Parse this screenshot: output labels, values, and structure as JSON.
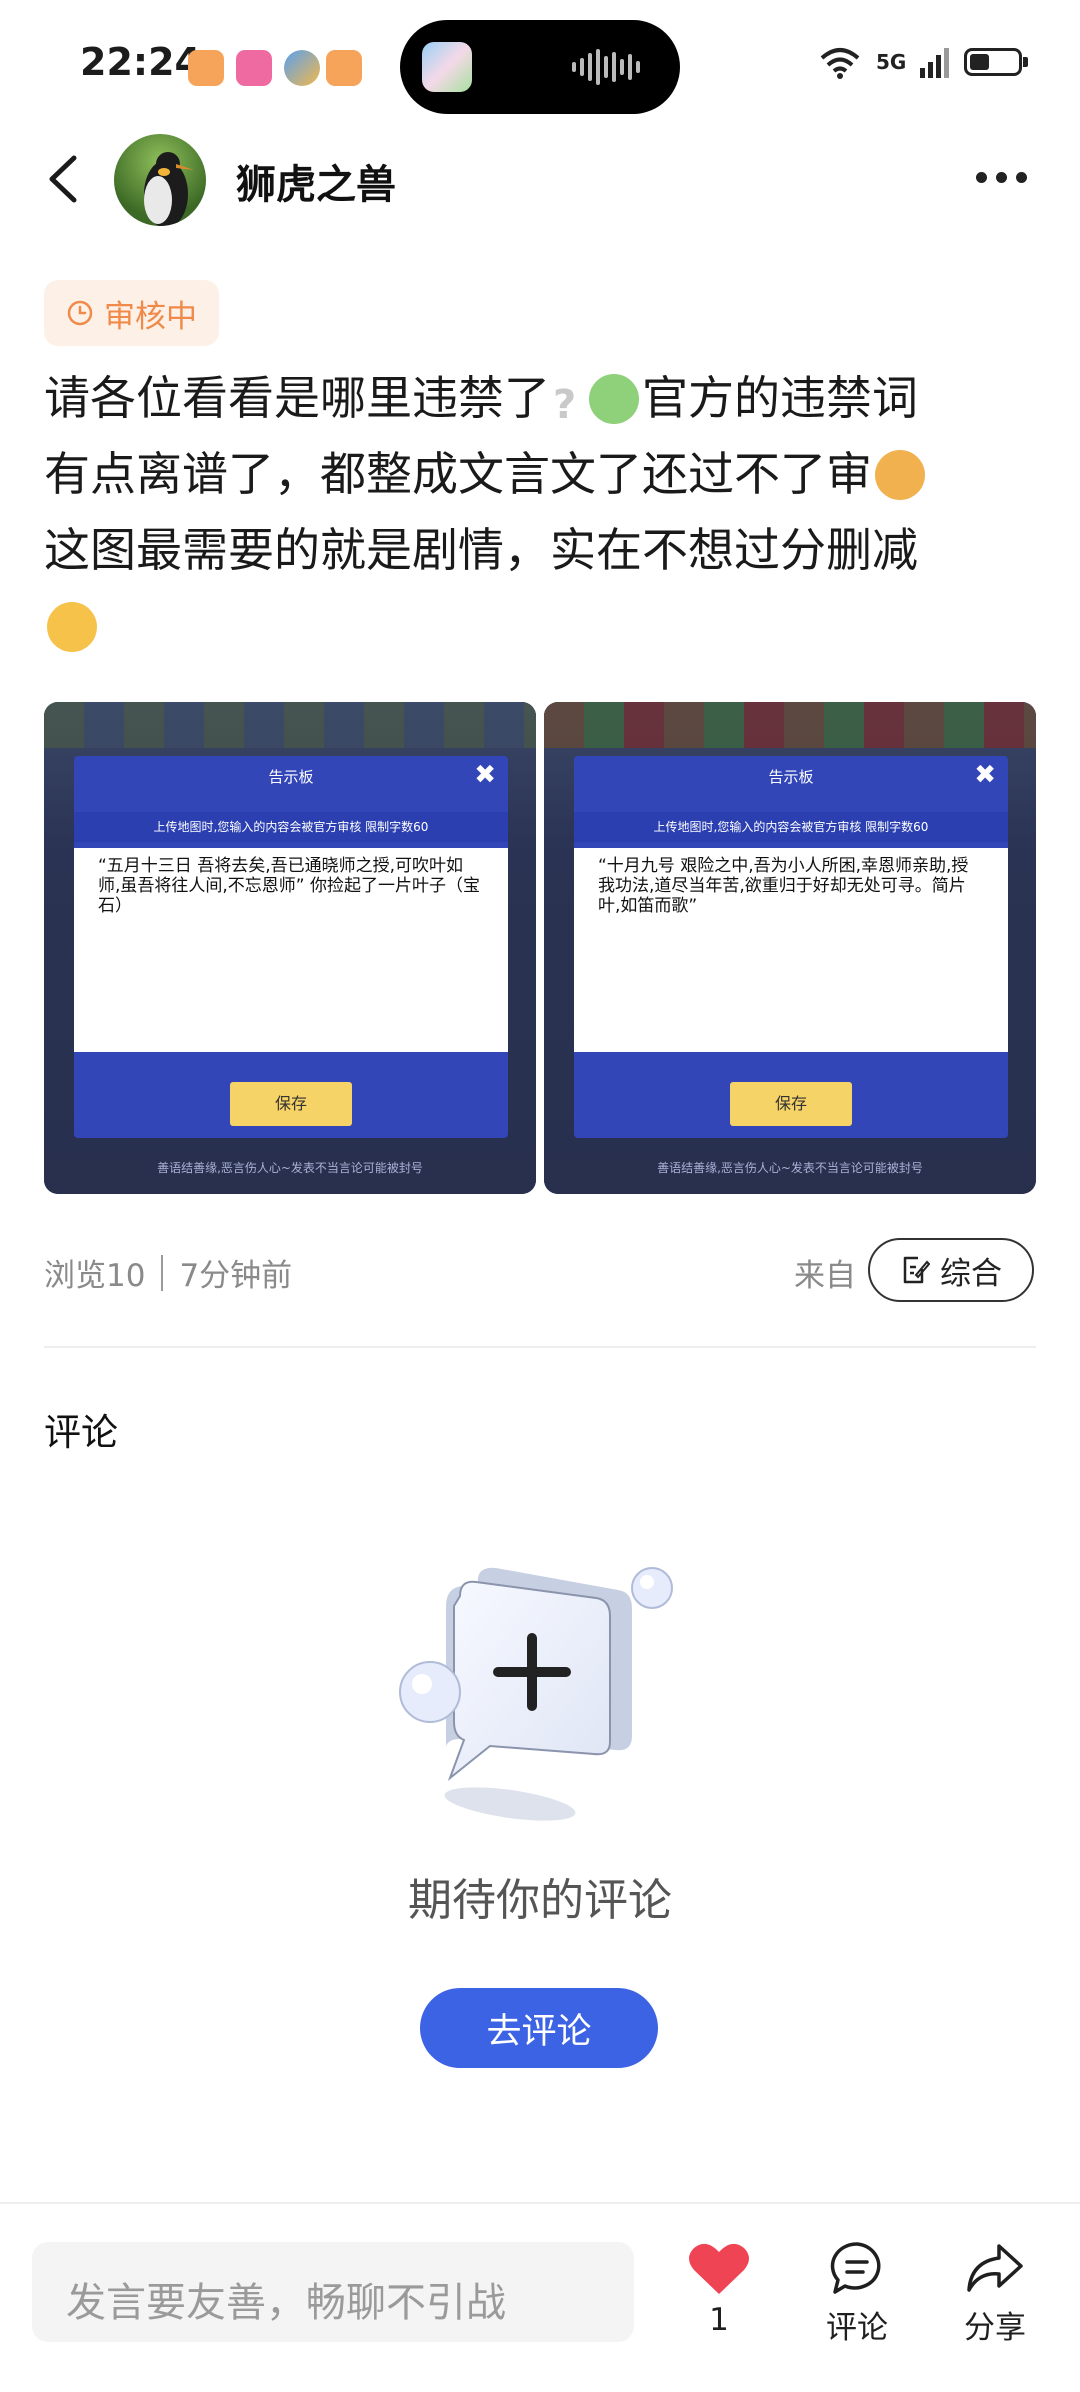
{
  "status_bar": {
    "time": "22:24",
    "network": "5G"
  },
  "header": {
    "author_name": "狮虎之兽"
  },
  "post": {
    "audit_status": "审核中",
    "text_line1a": "请各位看看是哪里违禁了",
    "text_line1b": "官方的违禁词",
    "text_line2": "有点离谱了，都整成文言文了还过不了审",
    "text_line3": "这图最需要的就是剧情，实在不想过分删减",
    "images": [
      {
        "dialog_title": "告示板",
        "dialog_subtitle": "上传地图时,您输入的内容会被官方审核 限制字数60",
        "dialog_text": "“五月十三日 吾将去矣,吾已通晓师之授,可吹叶如师,虽吾将往人间,不忘恩师” 你捡起了一片叶子（宝石）",
        "save_label": "保存",
        "footer": "善语结善缘,恶言伤人心~发表不当言论可能被封号"
      },
      {
        "dialog_title": "告示板",
        "dialog_subtitle": "上传地图时,您输入的内容会被官方审核 限制字数60",
        "dialog_text": "“十月九号 艰险之中,吾为小人所困,幸恩师亲助,授我功法,道尽当年苦,欲重归于好却无处可寻。简片叶,如笛而歌”",
        "save_label": "保存",
        "footer": "善语结善缘,恶言伤人心~发表不当言论可能被封号"
      }
    ],
    "views": "浏览10",
    "time_ago": "7分钟前",
    "from_label": "来自",
    "category": "综合"
  },
  "comments": {
    "title": "评论",
    "empty_text": "期待你的评论",
    "go_comment_label": "去评论"
  },
  "bottom_bar": {
    "input_placeholder": "发言要友善，畅聊不引战",
    "like_count": "1",
    "comment_label": "评论",
    "share_label": "分享",
    "like_color": "#ee4454"
  },
  "colors": {
    "primary_button": "#3d63e5",
    "audit_text": "#f08a4b",
    "audit_bg": "#fdf1e7"
  }
}
